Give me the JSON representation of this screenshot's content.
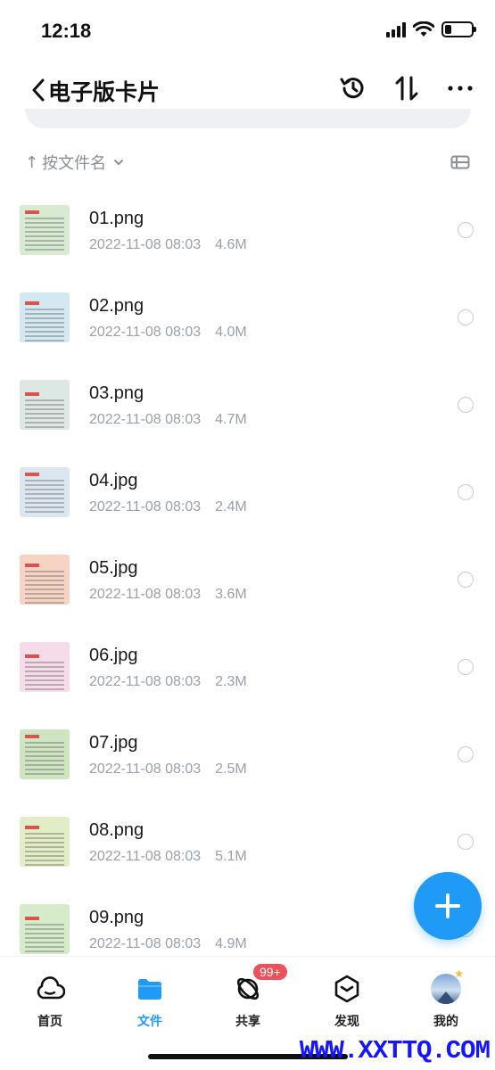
{
  "status_bar": {
    "time": "12:18",
    "battery_level": 0.25
  },
  "nav": {
    "title": "电子版卡片",
    "back_icon": "chevron-left-icon",
    "actions": [
      "history-icon",
      "sort-updown-icon",
      "more-icon"
    ]
  },
  "sort": {
    "arrow": "↑",
    "label": "按文件名"
  },
  "files": [
    {
      "name": "01.png",
      "date": "2022-11-08 08:03",
      "size": "4.6M",
      "thumb": "#d8ead2"
    },
    {
      "name": "02.png",
      "date": "2022-11-08 08:03",
      "size": "4.0M",
      "thumb": "#d3e8f0"
    },
    {
      "name": "03.png",
      "date": "2022-11-08 08:03",
      "size": "4.7M",
      "thumb": "#dde7e4"
    },
    {
      "name": "04.jpg",
      "date": "2022-11-08 08:03",
      "size": "2.4M",
      "thumb": "#dce6f0"
    },
    {
      "name": "05.jpg",
      "date": "2022-11-08 08:03",
      "size": "3.6M",
      "thumb": "#f7d3c4"
    },
    {
      "name": "06.jpg",
      "date": "2022-11-08 08:03",
      "size": "2.3M",
      "thumb": "#f6dbe8"
    },
    {
      "name": "07.jpg",
      "date": "2022-11-08 08:03",
      "size": "2.5M",
      "thumb": "#cfe5c2"
    },
    {
      "name": "08.png",
      "date": "2022-11-08 08:03",
      "size": "5.1M",
      "thumb": "#e2ecc6"
    },
    {
      "name": "09.png",
      "date": "2022-11-08 08:03",
      "size": "4.9M",
      "thumb": "#d6ebc9"
    }
  ],
  "fab": {
    "icon": "plus-icon"
  },
  "tabs": [
    {
      "label": "首页",
      "icon": "cloud-icon"
    },
    {
      "label": "文件",
      "icon": "folder-icon",
      "active": true
    },
    {
      "label": "共享",
      "icon": "orbit-icon",
      "badge": "99+"
    },
    {
      "label": "发现",
      "icon": "cube-icon"
    },
    {
      "label": "我的",
      "icon": "avatar-icon"
    }
  ],
  "watermark": "WWW.XXTTQ.COM",
  "colors": {
    "accent": "#1f9bf7",
    "badge": "#f0505a",
    "meta_text": "#9aa0a8"
  }
}
